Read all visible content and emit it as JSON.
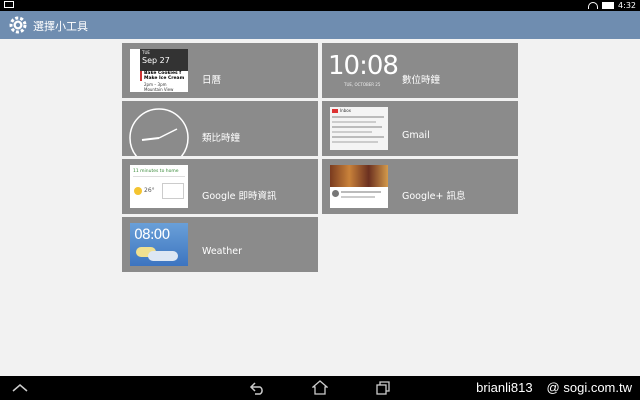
{
  "status_bar": {
    "time": "4:32"
  },
  "action_bar": {
    "title": "選擇小工具"
  },
  "widgets": [
    {
      "label": "日曆",
      "preview": {
        "day": "TUE",
        "date": "Sep 27",
        "line1": "Bake Cookies f",
        "line2": "Make Ice Cream",
        "line3": "2pm – 3pm",
        "line4": "Mountain View"
      }
    },
    {
      "label": "數位時鐘",
      "preview": {
        "time": "10:08",
        "date": "TUE, OCTOBER 25"
      }
    },
    {
      "label": "類比時鐘"
    },
    {
      "label": "Gmail",
      "preview": {
        "app": "Inbox"
      }
    },
    {
      "label": "Google 即時資訊",
      "preview": {
        "route": "11 minutes to home",
        "temp": "26°"
      }
    },
    {
      "label": "Google+ 訊息"
    },
    {
      "label": "Weather",
      "preview": {
        "time": "08:00"
      }
    }
  ],
  "watermark": {
    "user": "brianli813",
    "site": "@ sogi.com.tw"
  },
  "colors": {
    "action_bar": "#6f8db0",
    "card": "#8b8b8b",
    "background": "#f2f2f2"
  }
}
